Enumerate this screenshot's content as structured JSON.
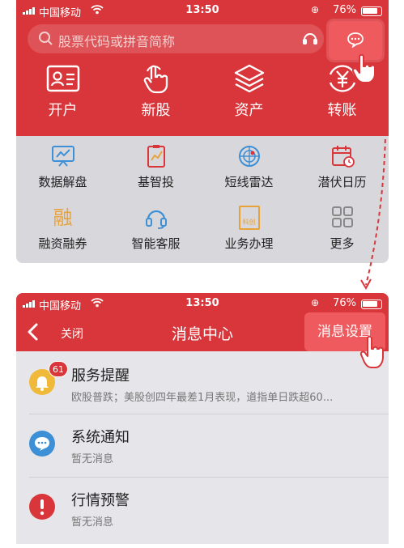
{
  "statusbar": {
    "carrier": "中国移动",
    "time": "13:50",
    "battery": "76%"
  },
  "home": {
    "search": {
      "placeholder": "股票代码或拼音简称"
    },
    "tiles": [
      {
        "label": "开户",
        "icon": "id-card-icon"
      },
      {
        "label": "新股",
        "icon": "tap-hand-icon"
      },
      {
        "label": "资产",
        "icon": "layers-icon"
      },
      {
        "label": "转账",
        "icon": "yen-transfer-icon"
      }
    ],
    "grid": [
      {
        "label": "数据解盘",
        "icon": "chart-board-icon"
      },
      {
        "label": "基智投",
        "icon": "fund-chart-icon"
      },
      {
        "label": "短线雷达",
        "icon": "radar-icon"
      },
      {
        "label": "潜伏日历",
        "icon": "calendar-icon"
      },
      {
        "label": "融资融券",
        "icon": "rong-icon",
        "glyph": "融"
      },
      {
        "label": "智能客服",
        "icon": "headset-icon"
      },
      {
        "label": "业务办理",
        "icon": "document-icon",
        "glyph": "科创"
      },
      {
        "label": "更多",
        "icon": "more-grid-icon"
      }
    ]
  },
  "messages": {
    "back_label": "关闭",
    "title": "消息中心",
    "settings_label": "消息设置",
    "items": [
      {
        "title": "服务提醒",
        "subtitle": "欧股普跌；美股创四年最差1月表现，道指单日跌超60...",
        "badge": "61",
        "icon": "bell-icon",
        "color": "#f0b93a"
      },
      {
        "title": "系统通知",
        "subtitle": "暂无消息",
        "icon": "chat-bubble-icon",
        "color": "#3d8fd6"
      },
      {
        "title": "行情预警",
        "subtitle": "暂无消息",
        "icon": "alert-icon",
        "color": "#d8363a"
      }
    ]
  },
  "colors": {
    "brand_red": "#d8363a",
    "highlight_red": "#ee5a5e",
    "accent_orange": "#e8a23a",
    "accent_blue": "#3d8fd6"
  }
}
